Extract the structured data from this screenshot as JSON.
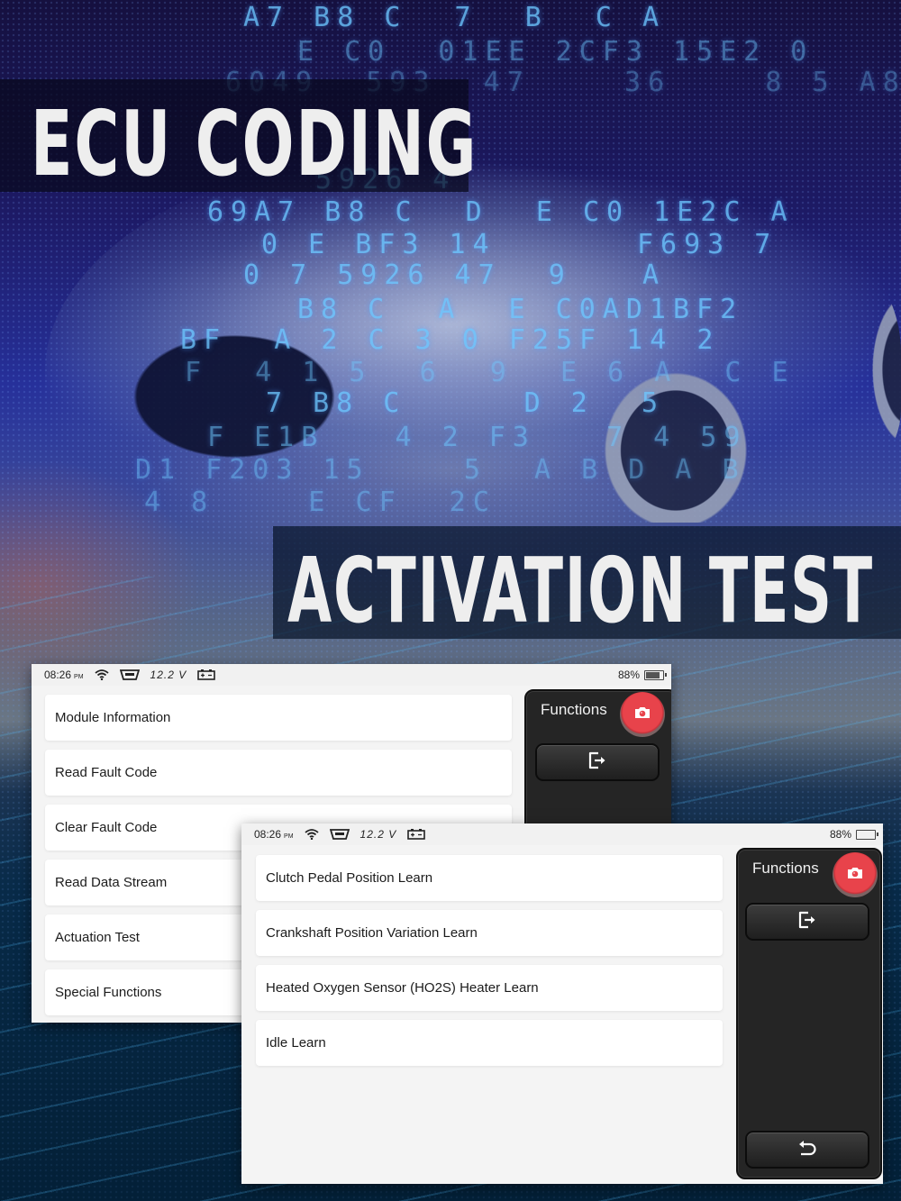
{
  "banners": {
    "top_title": "ECU CODING",
    "bottom_title": "ACTIVATION TEST"
  },
  "background": {
    "hex_rows": [
      "A7 B8 C  7  B  C A",
      "E C0  01EE 2CF3 15E2 0",
      "6049  593  47    36    8 5 A8",
      "5926 4",
      "69A7 B8 C  D  E C0 1E2C A",
      "0 E BF3 14      F693 7",
      "0 7 5926 47  9   A",
      "B8 C  A  E C0AD1BF2",
      "BF  A 2 C 3 0 F25F 14 2",
      "F  4 1 5  6  9  E 6 A  C E",
      "7 B8 C     D 2  5",
      "F E1B   4 2 F3   7 4 59",
      "D1 F203 15    5  A B D A B",
      "4 8    E CF  2C"
    ]
  },
  "screen_main": {
    "status": {
      "time": "08:26",
      "ampm": "PM",
      "wifi_icon": "wifi-icon",
      "obd_icon": "obd-connector-icon",
      "voltage": "12.2 V",
      "car_battery_icon": "car-battery-icon",
      "battery_percent": "88%",
      "battery_level": 0.88
    },
    "menu_items": [
      "Module Information",
      "Read Fault Code",
      "Clear Fault Code",
      "Read Data Stream",
      "Actuation Test",
      "Special Functions"
    ],
    "panel": {
      "title": "Functions",
      "camera_icon": "camera-icon",
      "exit_icon": "exit-icon"
    }
  },
  "screen_special": {
    "status": {
      "time": "08:26",
      "ampm": "PM",
      "wifi_icon": "wifi-icon",
      "obd_icon": "obd-connector-icon",
      "voltage": "12.2 V",
      "car_battery_icon": "car-battery-icon",
      "battery_percent": "88%",
      "battery_level": 0.0
    },
    "menu_items": [
      "Clutch Pedal Position Learn",
      "Crankshaft Position Variation Learn",
      "Heated Oxygen Sensor (HO2S) Heater Learn",
      "Idle Learn"
    ],
    "panel": {
      "title": "Functions",
      "camera_icon": "camera-icon",
      "exit_icon": "exit-icon",
      "back_icon": "back-icon"
    }
  },
  "colors": {
    "camera_red": "#e8434b",
    "panel_dark": "#252525",
    "screen_bg": "#f4f4f4",
    "banner_text": "#eeeeee"
  }
}
